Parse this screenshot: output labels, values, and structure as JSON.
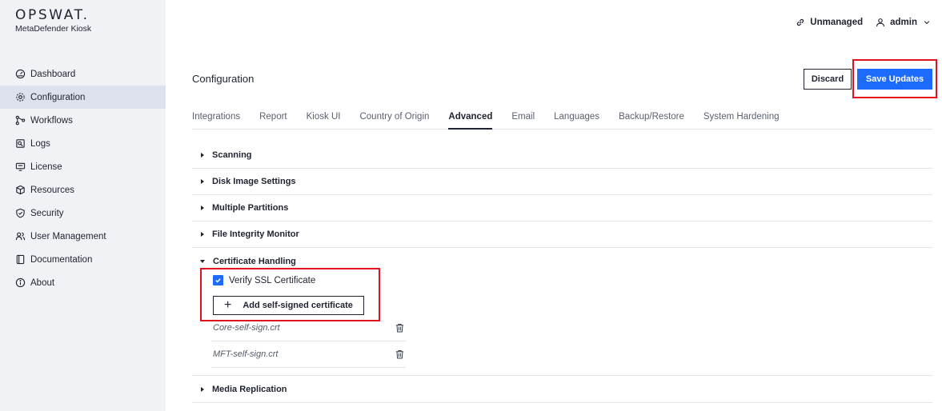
{
  "app": {
    "brand": "OPSWAT.",
    "product": "MetaDefender Kiosk"
  },
  "sidebar": {
    "items": [
      {
        "label": "Dashboard",
        "icon": "dashboard-icon",
        "active": false
      },
      {
        "label": "Configuration",
        "icon": "gear-icon",
        "active": true
      },
      {
        "label": "Workflows",
        "icon": "workflow-icon",
        "active": false
      },
      {
        "label": "Logs",
        "icon": "logs-icon",
        "active": false
      },
      {
        "label": "License",
        "icon": "license-icon",
        "active": false
      },
      {
        "label": "Resources",
        "icon": "cube-icon",
        "active": false
      },
      {
        "label": "Security",
        "icon": "shield-icon",
        "active": false
      },
      {
        "label": "User Management",
        "icon": "users-icon",
        "active": false
      },
      {
        "label": "Documentation",
        "icon": "book-icon",
        "active": false
      },
      {
        "label": "About",
        "icon": "info-icon",
        "active": false
      }
    ]
  },
  "topbar": {
    "status": "Unmanaged",
    "user": "admin"
  },
  "page": {
    "title": "Configuration",
    "discard_label": "Discard",
    "save_label": "Save Updates"
  },
  "tabs": [
    {
      "label": "Integrations",
      "active": false
    },
    {
      "label": "Report",
      "active": false
    },
    {
      "label": "Kiosk UI",
      "active": false
    },
    {
      "label": "Country of Origin",
      "active": false
    },
    {
      "label": "Advanced",
      "active": true
    },
    {
      "label": "Email",
      "active": false
    },
    {
      "label": "Languages",
      "active": false
    },
    {
      "label": "Backup/Restore",
      "active": false
    },
    {
      "label": "System Hardening",
      "active": false
    }
  ],
  "sections": [
    {
      "label": "Scanning",
      "expanded": false
    },
    {
      "label": "Disk Image Settings",
      "expanded": false
    },
    {
      "label": "Multiple Partitions",
      "expanded": false
    },
    {
      "label": "File Integrity Monitor",
      "expanded": false
    },
    {
      "label": "Certificate Handling",
      "expanded": true
    },
    {
      "label": "Media Replication",
      "expanded": false
    }
  ],
  "certificate_handling": {
    "verify_ssl_label": "Verify SSL Certificate",
    "verify_ssl_checked": true,
    "add_button_label": "Add self-signed certificate",
    "certificates": [
      "Core-self-sign.crt",
      "MFT-self-sign.crt"
    ]
  },
  "colors": {
    "accent": "#1d6bfc",
    "highlight": "#e0121c",
    "sidebar_bg": "#f1f2f6",
    "sidebar_active": "#dde1ee"
  }
}
